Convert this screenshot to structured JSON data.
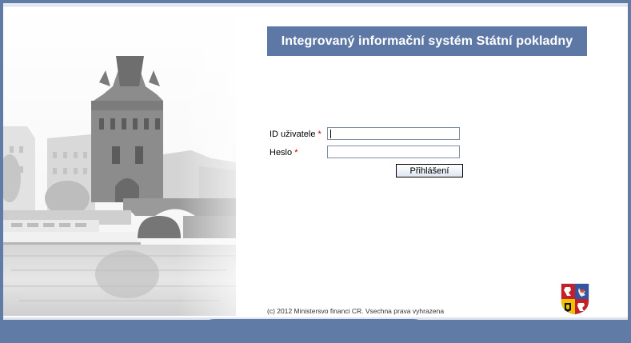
{
  "header": {
    "title": "Integrovaný informační systém Státní pokladny"
  },
  "form": {
    "user_id_label": "ID uživatele",
    "password_label": "Heslo",
    "required_marker": "*",
    "user_id_value": "",
    "password_value": "",
    "login_button": "Přihlášení"
  },
  "footer": {
    "copyright": "(c) 2012 Ministersvo financi CR. Vsechna prava vyhrazena"
  },
  "colors": {
    "brand": "#5e78a6",
    "frame": "#5f7ba6",
    "required": "#c00000"
  },
  "icons": {
    "emblem": "czech-coat-of-arms-icon",
    "photo": "prague-bridge-tower-photo"
  }
}
